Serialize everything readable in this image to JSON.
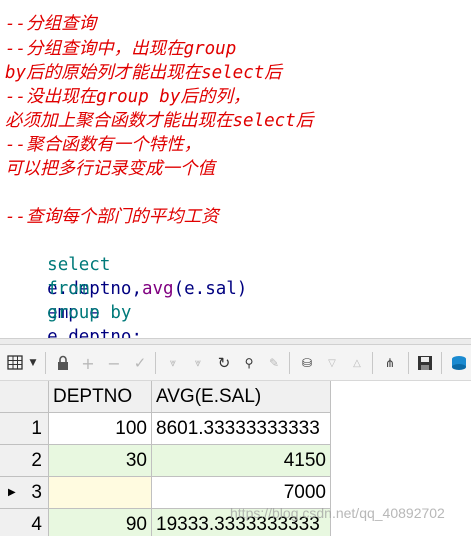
{
  "editor": {
    "lines": [
      "--分组查询",
      "--分组查询中，出现在group",
      "by后的原始列才能出现在select后",
      "--没出现在group by后的列，",
      "必须加上聚合函数才能出现在select后",
      "--聚合函数有一个特性，",
      "可以把多行记录变成一个值",
      "",
      "--查询每个部门的平均工资"
    ],
    "sql": {
      "select_kw": "select",
      "select_col": "e.deptno,",
      "avg_fn": "avg",
      "avg_arg": "(e.sal)",
      "from_kw": "from",
      "from_table": "emp e",
      "group_kw": "group by",
      "group_col": "e.deptno;"
    }
  },
  "grid": {
    "columns": [
      "DEPTNO",
      "AVG(E.SAL)"
    ],
    "rows": [
      {
        "num": "1",
        "deptno": "100",
        "avg": "8601.33333333333"
      },
      {
        "num": "2",
        "deptno": "30",
        "avg": "4150"
      },
      {
        "num": "3",
        "deptno": "",
        "avg": "7000",
        "current": true
      },
      {
        "num": "4",
        "deptno": "90",
        "avg": "19333.3333333333"
      }
    ]
  },
  "watermark": "https://blog.csdn.net/qq_40892702",
  "colors": {
    "comment": "#e00000",
    "keyword": "#007a7a",
    "identifier": "#000080",
    "function": "#800080",
    "row_even": "#e8f8e0",
    "row_current": "#fffbe0"
  }
}
